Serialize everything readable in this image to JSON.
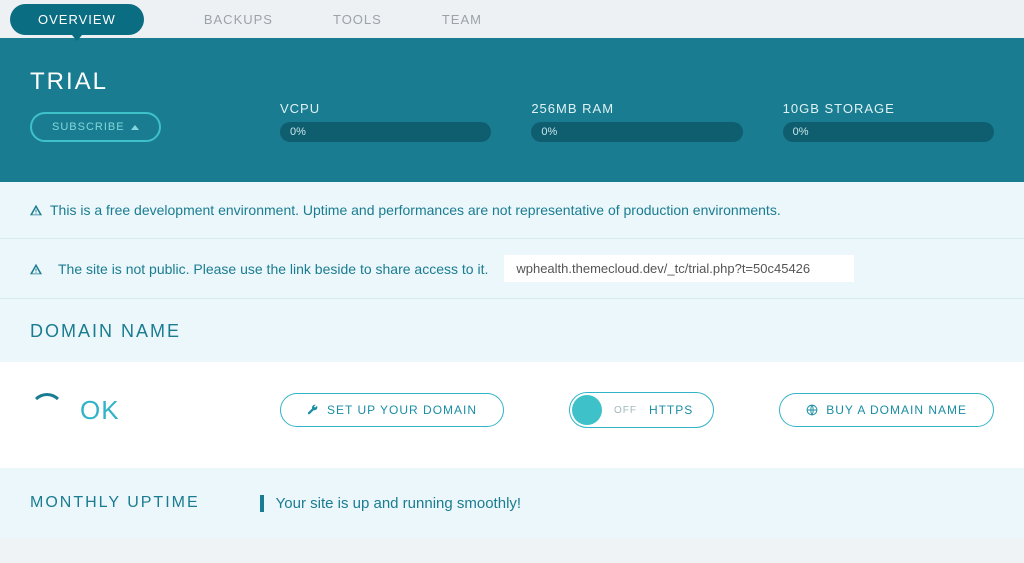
{
  "tabs": {
    "overview": "OVERVIEW",
    "backups": "BACKUPS",
    "tools": "TOOLS",
    "team": "TEAM"
  },
  "hero": {
    "plan": "TRIAL",
    "subscribe": "SUBSCRIBE",
    "metrics": {
      "vcpu": {
        "label": "VCPU",
        "value": "0%"
      },
      "ram": {
        "label": "256MB RAM",
        "value": "0%"
      },
      "storage": {
        "label": "10GB STORAGE",
        "value": "0%"
      }
    }
  },
  "alerts": {
    "dev_env": "This is a free development environment. Uptime and performances are not representative of production environments.",
    "not_public": "The site is not public. Please use the link beside to share access to it.",
    "share_url": "wphealth.themecloud.dev/_tc/trial.php?t=50c45426"
  },
  "domain": {
    "section_title": "DOMAIN NAME",
    "status": "OK",
    "setup_btn": "SET UP YOUR DOMAIN",
    "https_toggle": {
      "state": "OFF",
      "label": "HTTPS"
    },
    "buy_btn": "BUY A DOMAIN NAME"
  },
  "uptime": {
    "title": "MONTHLY UPTIME",
    "message": "Your site is up and running smoothly!"
  }
}
